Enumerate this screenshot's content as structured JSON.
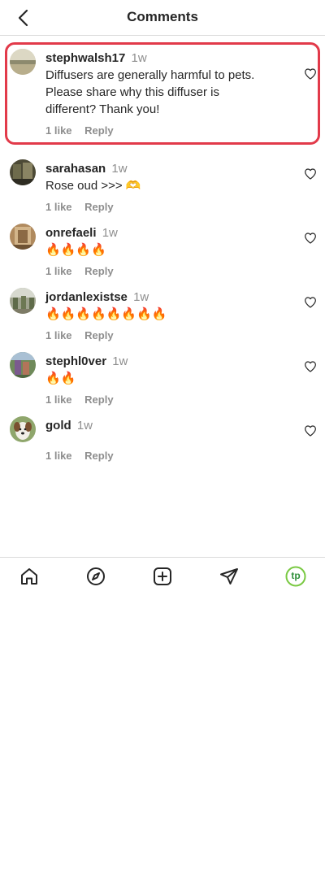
{
  "header": {
    "title": "Comments"
  },
  "comments": [
    {
      "username": "stephwalsh17",
      "time": "1w",
      "text_lines": [
        "Diffusers are generally harmful to pets.",
        "Please share why this diffuser is",
        "different? Thank you!"
      ],
      "likes": "1 like",
      "reply": "Reply",
      "highlighted": true
    },
    {
      "username": "sarahasan",
      "time": "1w",
      "text": "Rose oud >>> 🫶",
      "likes": "1 like",
      "reply": "Reply"
    },
    {
      "username": "onrefaeli",
      "time": "1w",
      "text": "🔥🔥🔥🔥",
      "likes": "1 like",
      "reply": "Reply"
    },
    {
      "username": "jordanlexistse",
      "time": "1w",
      "text": "🔥🔥🔥🔥🔥🔥🔥🔥",
      "likes": "1 like",
      "reply": "Reply"
    },
    {
      "username": "stephl0ver",
      "time": "1w",
      "text": "🔥🔥",
      "likes": "1 like",
      "reply": "Reply"
    },
    {
      "username": "gold",
      "time": "1w",
      "text": "",
      "likes": "1 like",
      "reply": "Reply"
    }
  ],
  "nav": {
    "profile_initials": "tp"
  },
  "colors": {
    "highlight_border": "#e23a4a",
    "muted_text": "#8e8e8e",
    "profile_accent": "#7ac943"
  }
}
